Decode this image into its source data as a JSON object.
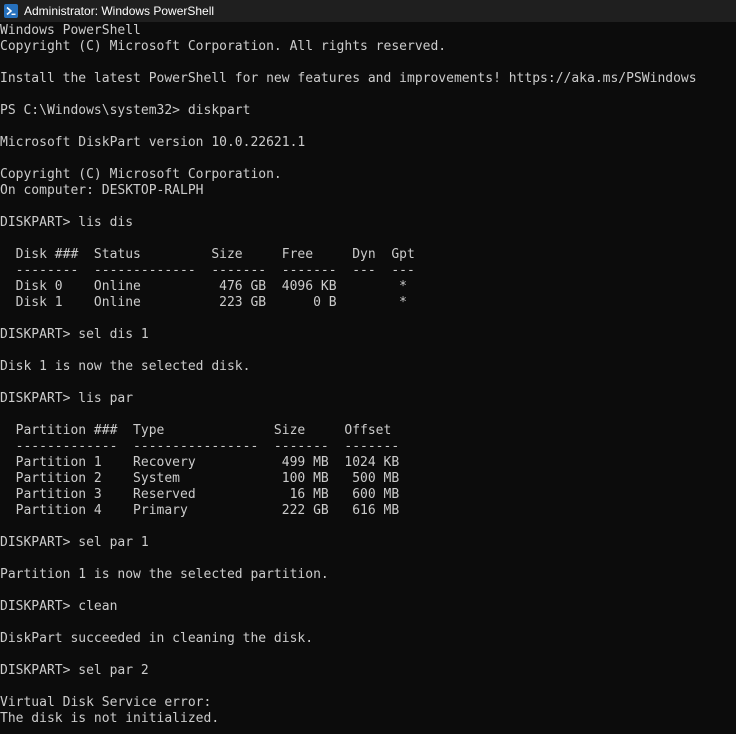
{
  "window": {
    "title": "Administrator: Windows PowerShell",
    "icon": "powershell-icon",
    "background_color": "#0c0c0c",
    "text_color": "#cccccc",
    "titlebar_color": "#1f1f1f"
  },
  "console": {
    "lines": [
      "Windows PowerShell",
      "Copyright (C) Microsoft Corporation. All rights reserved.",
      "",
      "Install the latest PowerShell for new features and improvements! https://aka.ms/PSWindows",
      "",
      "PS C:\\Windows\\system32> diskpart",
      "",
      "Microsoft DiskPart version 10.0.22621.1",
      "",
      "Copyright (C) Microsoft Corporation.",
      "On computer: DESKTOP-RALPH",
      "",
      "DISKPART> lis dis",
      "",
      "  Disk ###  Status         Size     Free     Dyn  Gpt",
      "  --------  -------------  -------  -------  ---  ---",
      "  Disk 0    Online          476 GB  4096 KB        *",
      "  Disk 1    Online          223 GB      0 B        *",
      "",
      "DISKPART> sel dis 1",
      "",
      "Disk 1 is now the selected disk.",
      "",
      "DISKPART> lis par",
      "",
      "  Partition ###  Type              Size     Offset",
      "  -------------  ----------------  -------  -------",
      "  Partition 1    Recovery           499 MB  1024 KB",
      "  Partition 2    System             100 MB   500 MB",
      "  Partition 3    Reserved            16 MB   600 MB",
      "  Partition 4    Primary            222 GB   616 MB",
      "",
      "DISKPART> sel par 1",
      "",
      "Partition 1 is now the selected partition.",
      "",
      "DISKPART> clean",
      "",
      "DiskPart succeeded in cleaning the disk.",
      "",
      "DISKPART> sel par 2",
      "",
      "Virtual Disk Service error:",
      "The disk is not initialized."
    ]
  }
}
